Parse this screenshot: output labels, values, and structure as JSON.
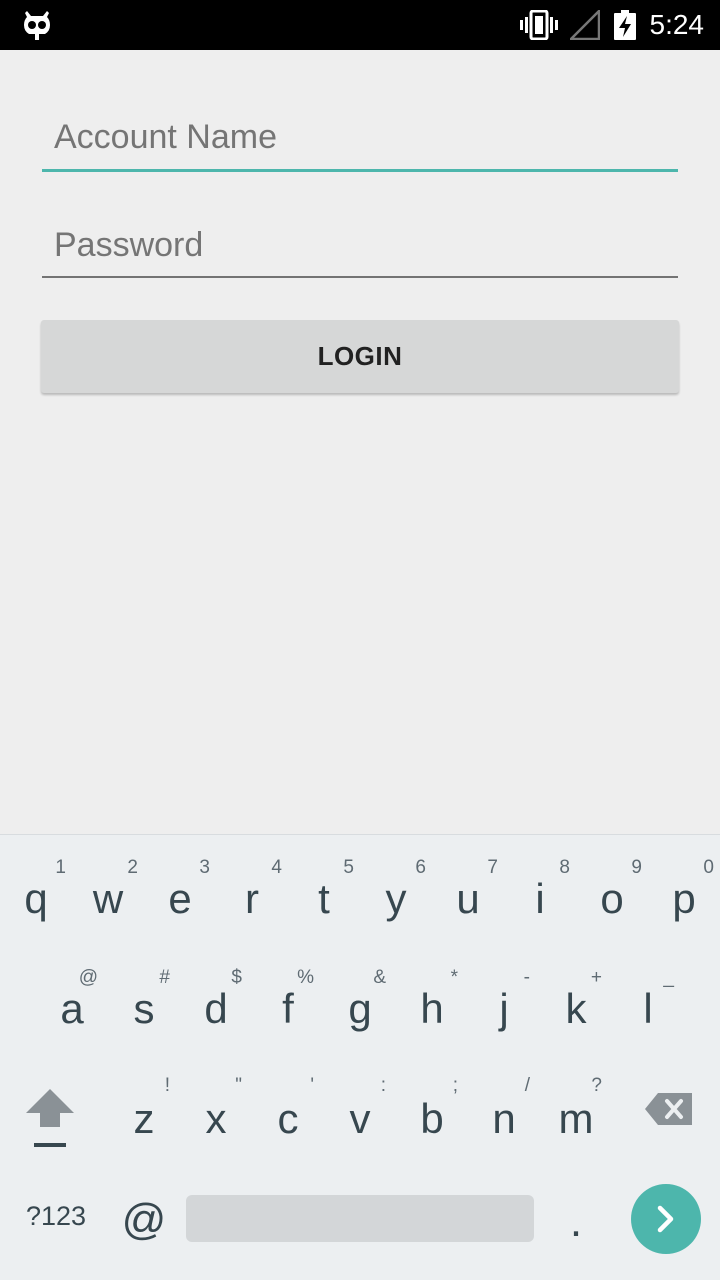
{
  "status_bar": {
    "time": "5:24",
    "icons": [
      "cyanogen-bug-icon",
      "vibrate-icon",
      "no-signal-icon",
      "battery-charging-icon"
    ]
  },
  "form": {
    "account_placeholder": "Account Name",
    "password_placeholder": "Password",
    "login_label": "LOGIN",
    "accent_color": "#4db6ac"
  },
  "keyboard": {
    "row1": [
      {
        "key": "q",
        "hint": "1"
      },
      {
        "key": "w",
        "hint": "2"
      },
      {
        "key": "e",
        "hint": "3"
      },
      {
        "key": "r",
        "hint": "4"
      },
      {
        "key": "t",
        "hint": "5"
      },
      {
        "key": "y",
        "hint": "6"
      },
      {
        "key": "u",
        "hint": "7"
      },
      {
        "key": "i",
        "hint": "8"
      },
      {
        "key": "o",
        "hint": "9"
      },
      {
        "key": "p",
        "hint": "0"
      }
    ],
    "row2": [
      {
        "key": "a",
        "hint": "@"
      },
      {
        "key": "s",
        "hint": "#"
      },
      {
        "key": "d",
        "hint": "$"
      },
      {
        "key": "f",
        "hint": "%"
      },
      {
        "key": "g",
        "hint": "&"
      },
      {
        "key": "h",
        "hint": "*"
      },
      {
        "key": "j",
        "hint": "-"
      },
      {
        "key": "k",
        "hint": "+"
      },
      {
        "key": "l",
        "hint": "_"
      }
    ],
    "row3": [
      {
        "key": "z",
        "hint": "!"
      },
      {
        "key": "x",
        "hint": "\""
      },
      {
        "key": "c",
        "hint": "'"
      },
      {
        "key": "v",
        "hint": ":"
      },
      {
        "key": "b",
        "hint": ";"
      },
      {
        "key": "n",
        "hint": "/"
      },
      {
        "key": "m",
        "hint": "?"
      }
    ],
    "symbols_label": "?123",
    "at_label": "@",
    "period_label": "."
  }
}
